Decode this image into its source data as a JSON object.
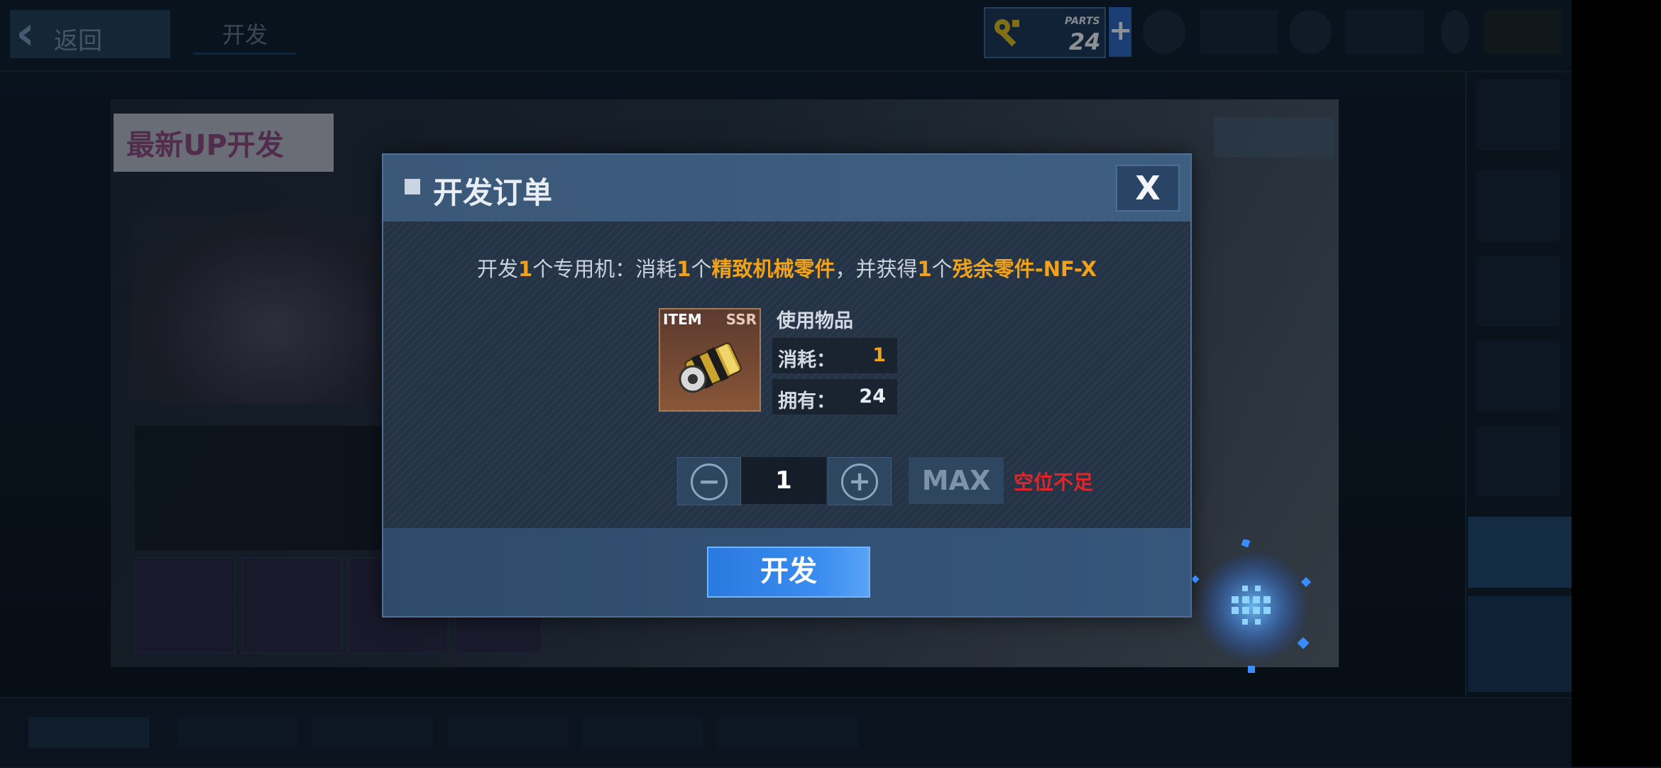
{
  "top": {
    "back_label": "返回",
    "tab_label": "开发",
    "parts": {
      "label": "PARTS",
      "value": "24"
    }
  },
  "background": {
    "banner_tag": "最新UP开发"
  },
  "dialog": {
    "title": "开发订单",
    "close_glyph": "X",
    "description": {
      "p1": "开发",
      "n1": "1",
      "p2": "个专用机：消耗",
      "n2": "1",
      "p3": "个",
      "item1": "精致机械零件",
      "p4": "，并获得",
      "n3": "1",
      "p5": "个",
      "item2": "残余零件-NF-X"
    },
    "item": {
      "label": "ITEM",
      "rarity": "SSR",
      "use_label": "使用物品",
      "consume_key": "消耗：",
      "consume_val": "1",
      "own_key": "拥有：",
      "own_val": "24"
    },
    "quantity": {
      "minus": "−",
      "plus": "+",
      "value": "1",
      "max_label": "MAX",
      "warning": "空位不足"
    },
    "confirm_label": "开发"
  },
  "colors": {
    "highlight": "#f0a21a",
    "warning": "#e0262b",
    "primary_button": "#2a79e0"
  }
}
